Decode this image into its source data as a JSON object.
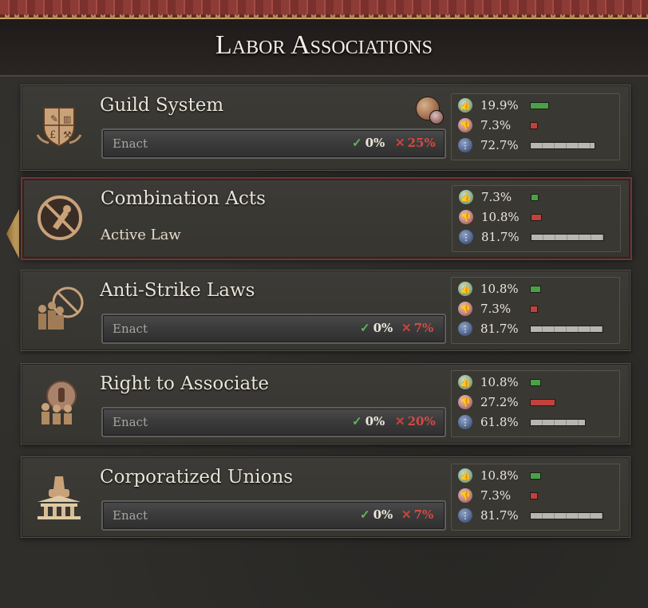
{
  "header": {
    "title": "Labor Associations"
  },
  "laws": [
    {
      "name": "Guild System",
      "emblem_icon": "shield-crest-icon",
      "status": "enact",
      "enact_label": "Enact",
      "yes": "0%",
      "no": "25%",
      "support": {
        "up": "19.9%",
        "down": "7.3%",
        "neutral": "72.7%"
      },
      "bars": {
        "up": 0.199,
        "down": 0.073,
        "neutral": 0.727
      }
    },
    {
      "name": "Combination Acts",
      "emblem_icon": "banned-tools-icon",
      "status": "active",
      "active_label": "Active Law",
      "support": {
        "up": "7.3%",
        "down": "10.8%",
        "neutral": "81.7%"
      },
      "bars": {
        "up": 0.073,
        "down": 0.108,
        "neutral": 0.817
      }
    },
    {
      "name": "Anti-Strike Laws",
      "emblem_icon": "workers-banned-icon",
      "status": "enact",
      "enact_label": "Enact",
      "yes": "0%",
      "no": "7%",
      "support": {
        "up": "10.8%",
        "down": "7.3%",
        "neutral": "81.7%"
      },
      "bars": {
        "up": 0.108,
        "down": 0.073,
        "neutral": 0.817
      }
    },
    {
      "name": "Right to Associate",
      "emblem_icon": "workers-fist-icon",
      "status": "enact",
      "enact_label": "Enact",
      "yes": "0%",
      "no": "20%",
      "support": {
        "up": "10.8%",
        "down": "27.2%",
        "neutral": "61.8%"
      },
      "bars": {
        "up": 0.108,
        "down": 0.272,
        "neutral": 0.618
      }
    },
    {
      "name": "Corporatized Unions",
      "emblem_icon": "fist-temple-icon",
      "status": "enact",
      "enact_label": "Enact",
      "yes": "0%",
      "no": "7%",
      "support": {
        "up": "10.8%",
        "down": "7.3%",
        "neutral": "81.7%"
      },
      "bars": {
        "up": 0.108,
        "down": 0.073,
        "neutral": 0.817
      }
    }
  ]
}
